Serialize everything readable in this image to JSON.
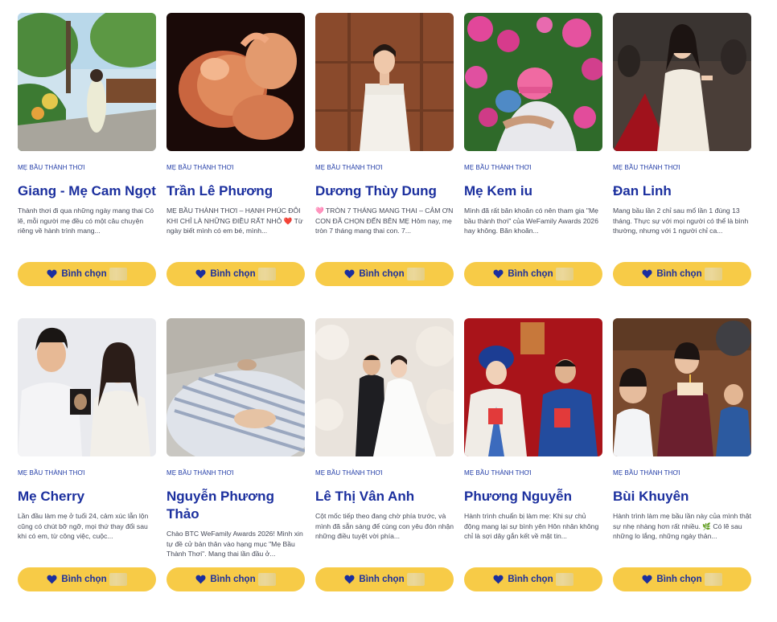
{
  "cards": [
    {
      "category": "MẸ BẦU THÀNH THƠI",
      "name": "Giang - Mẹ Cam Ngọt",
      "description": "Thành thơi đi qua những ngày mang thai Có lẽ, mỗi người mẹ đều có một câu chuyện riêng về hành trình mang...",
      "vote_label": "Bình chọn"
    },
    {
      "category": "MẸ BẦU THÀNH THƠI",
      "name": "Trần Lê Phương",
      "description": "MẸ BẦU THÀNH THƠI – HẠNH PHÚC ĐÔI KHI CHỈ LÀ NHỮNG ĐIỀU RẤT NHỎ ❤️ Từ ngày biết mình có em bé, mình...",
      "vote_label": "Bình chọn"
    },
    {
      "category": "MẸ BẦU THÀNH THƠI",
      "name": "Dương Thùy Dung",
      "description": "🩷 TRÒN 7 THÁNG MANG THAI – CẢM ƠN CON ĐÃ CHỌN ĐẾN BÊN MẸ Hôm nay, mẹ tròn 7 tháng mang thai con. 7...",
      "vote_label": "Bình chọn"
    },
    {
      "category": "MẸ BẦU THÀNH THƠI",
      "name": "Mẹ Kem iu",
      "description": "Mình đã rất băn khoăn có nên tham gia \"Mẹ bầu thành thơi\" của WeFamily Awards 2026 hay không. Băn khoăn...",
      "vote_label": "Bình chọn"
    },
    {
      "category": "MẸ BẦU THÀNH THƠI",
      "name": "Đan Linh",
      "description": "Mang bầu lần 2 chỉ sau mổ lần 1 đúng 13 tháng. Thực sự với mọi người có thể là bình thường, nhưng với 1 người chỉ ca...",
      "vote_label": "Bình chọn"
    },
    {
      "category": "MẸ BẦU THÀNH THƠI",
      "name": "Mẹ Cherry",
      "description": "Lần đầu làm mẹ ở tuổi 24, cảm xúc lẫn lộn cũng có chút bỡ ngỡ, mọi thứ thay đổi sau khi có em, từ công việc, cuộc...",
      "vote_label": "Bình chọn"
    },
    {
      "category": "MẸ BẦU THÀNH THƠI",
      "name": "Nguyễn Phương Thảo",
      "description": "Chào BTC WeFamily Awards 2026! Mình xin tự đề cử bản thân vào hạng mục \"Mẹ Bầu Thành Thơi\". Mang thai lần đầu ở...",
      "vote_label": "Bình chọn"
    },
    {
      "category": "MẸ BẦU THÀNH THƠI",
      "name": "Lê Thị Vân Anh",
      "description": "Cột mốc tiếp theo đang chờ phía trước, và mình đã sẵn sàng để cùng con yêu đón nhận những điều tuyệt vời phía...",
      "vote_label": "Bình chọn"
    },
    {
      "category": "MẸ BẦU THÀNH THƠI",
      "name": "Phương Nguyễn",
      "description": "Hành trình chuẩn bị làm mẹ: Khi sự chủ động mang lại sự bình yên Hôn nhân không chỉ là sợi dây gắn kết về mặt tin...",
      "vote_label": "Bình chọn"
    },
    {
      "category": "MẸ BẦU THÀNH THƠI",
      "name": "Bùi Khuyên",
      "description": "Hành trình làm mẹ bầu lần này của mình thật sự nhẹ nhàng hơn rất nhiều. 🌿 Có lẽ sau những lo lắng, những ngày thản...",
      "vote_label": "Bình chọn"
    }
  ],
  "colors": {
    "accent": "#1b2f9e",
    "button": "#f7cb47",
    "text": "#444857"
  },
  "icons": {
    "vote": "heart-icon"
  }
}
